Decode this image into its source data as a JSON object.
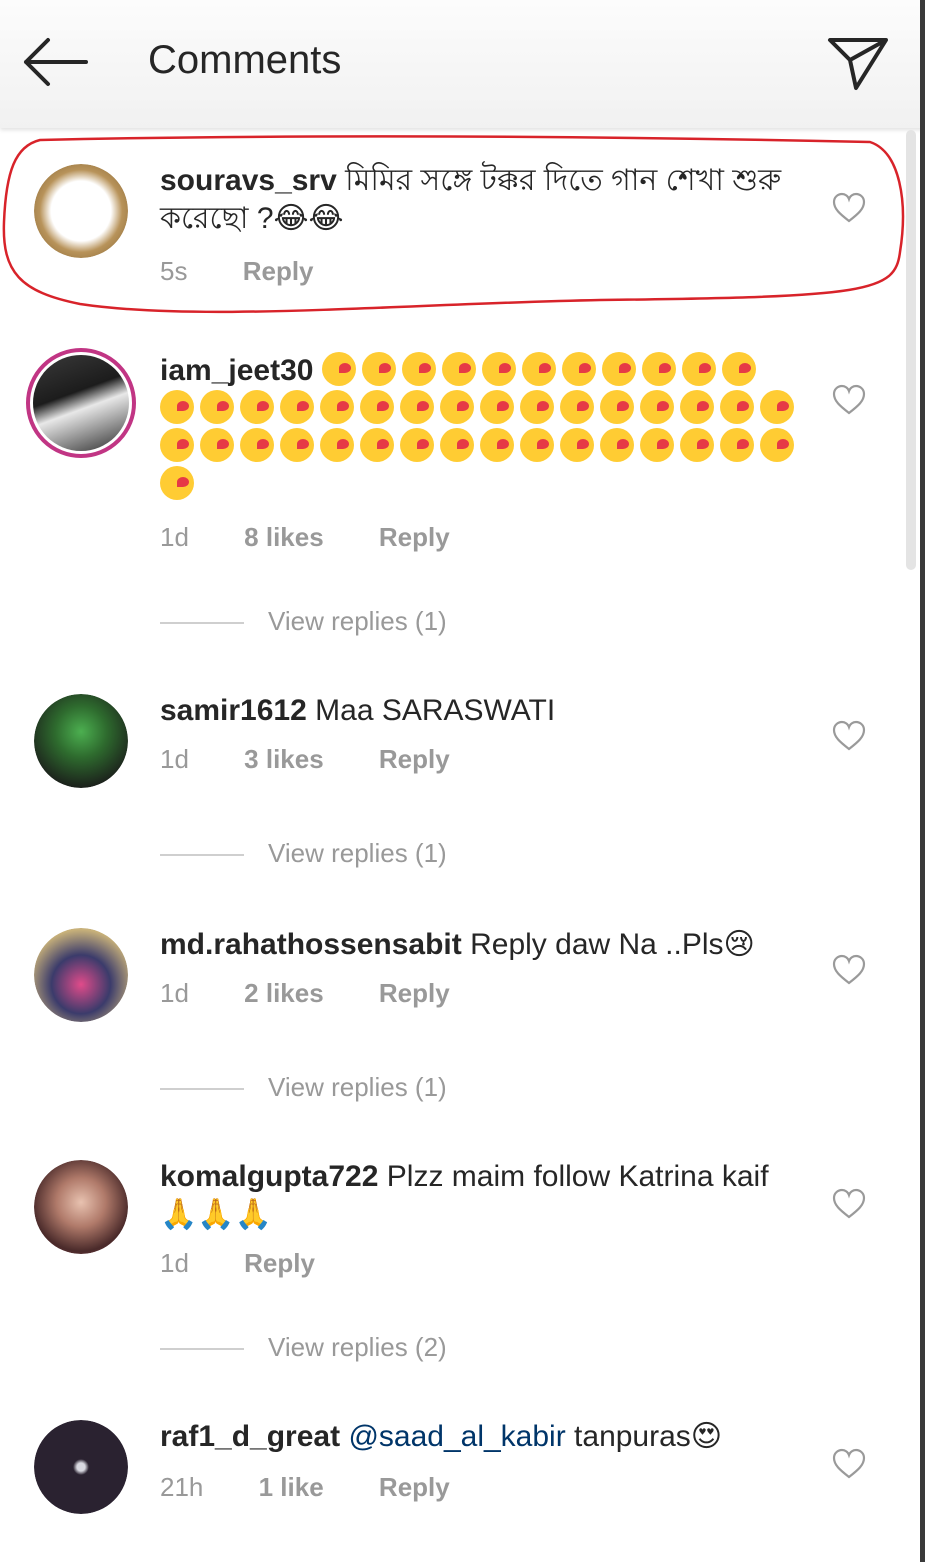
{
  "header": {
    "title": "Comments",
    "back_icon": "back-arrow-icon",
    "send_icon": "direct-send-icon"
  },
  "colors": {
    "highlight": "#d8232a",
    "text": "#262626",
    "meta": "#999999",
    "mention": "#003569",
    "ring": "#c13584"
  },
  "comments": [
    {
      "username": "souravs_srv",
      "text": "মিমির সঙ্গে টক্কর দিতে গান শেখা শুরু করেছো ?😂😂",
      "time": "5s",
      "likes": "",
      "reply": "Reply",
      "view_replies": ""
    },
    {
      "username": "iam_jeet30",
      "text": "😘😘😘😘😘😘😘😘😘😘😘😘😘😘😘😘😘😘😘😘😘😘😘😘😘😘😘😘😘😘😘😘😘😘😘😘😘😘😘😘😘😘😘😘😘😘😘😘😘😘😘😘😘😘😘😘😘😘😘😘😘😘😘😘😘😘😘😘😘😘😘😘😘😘😘😘😘😘😘😘😘😘😘😘😘😘😘😘😘",
      "time": "1d",
      "likes": "8 likes",
      "reply": "Reply",
      "view_replies": "View replies (1)"
    },
    {
      "username": "samir1612",
      "text": "Maa SARASWATI",
      "time": "1d",
      "likes": "3 likes",
      "reply": "Reply",
      "view_replies": "View replies (1)"
    },
    {
      "username": "md.rahathossensabit",
      "text": "Reply daw Na ..Pls😢",
      "time": "1d",
      "likes": "2 likes",
      "reply": "Reply",
      "view_replies": "View replies (1)"
    },
    {
      "username": "komalgupta722",
      "text": "Plzz maim follow Katrina kaif 🙏🙏🙏",
      "time": "1d",
      "likes": "",
      "reply": "Reply",
      "view_replies": "View replies (2)"
    },
    {
      "username": "raf1_d_great",
      "mention": "@saad_al_kabir",
      "text": "tanpuras😍",
      "time": "21h",
      "likes": "1 like",
      "reply": "Reply",
      "view_replies": ""
    }
  ]
}
